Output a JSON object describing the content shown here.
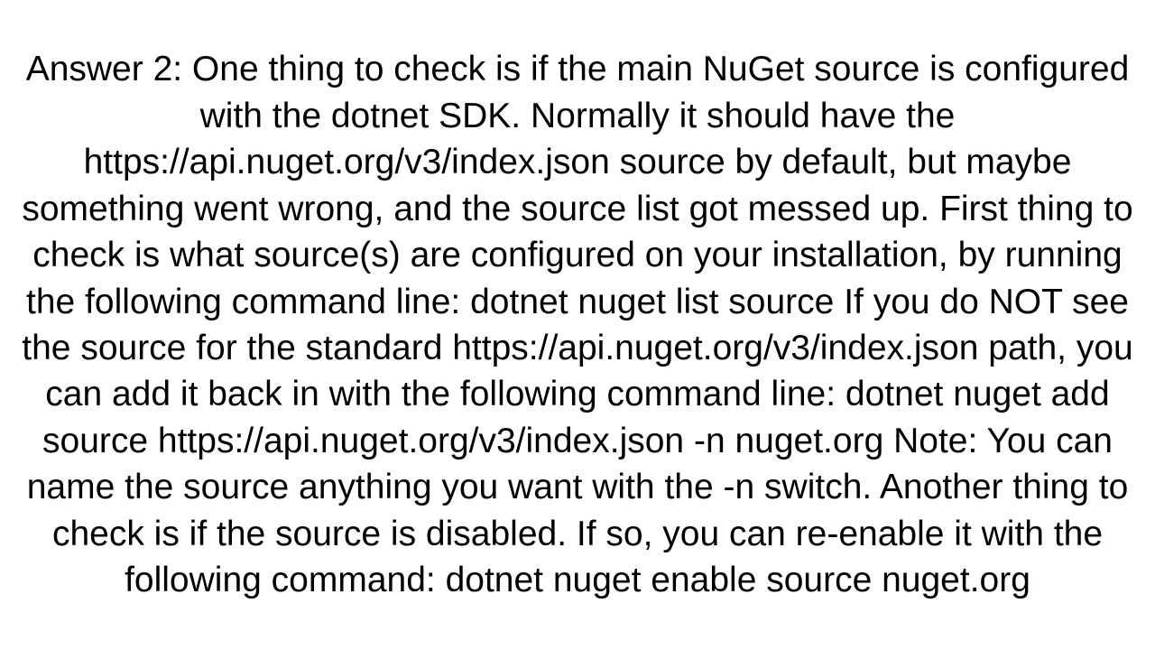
{
  "answer": {
    "text": "Answer 2: One thing to check is if the main NuGet source is configured with the dotnet SDK. Normally it should have the https://api.nuget.org/v3/index.json source by default, but maybe something went wrong, and the source list got messed up. First thing to check is what source(s) are configured on your installation, by running the following command line: dotnet nuget list source  If you do NOT see the source for the standard https://api.nuget.org/v3/index.json path, you can add it back in with the following command line: dotnet nuget add source https://api.nuget.org/v3/index.json -n nuget.org  Note: You can name the source anything you want with the -n switch. Another thing to check is if the source is disabled. If so, you can re-enable it with the following command: dotnet nuget enable source nuget.org"
  }
}
